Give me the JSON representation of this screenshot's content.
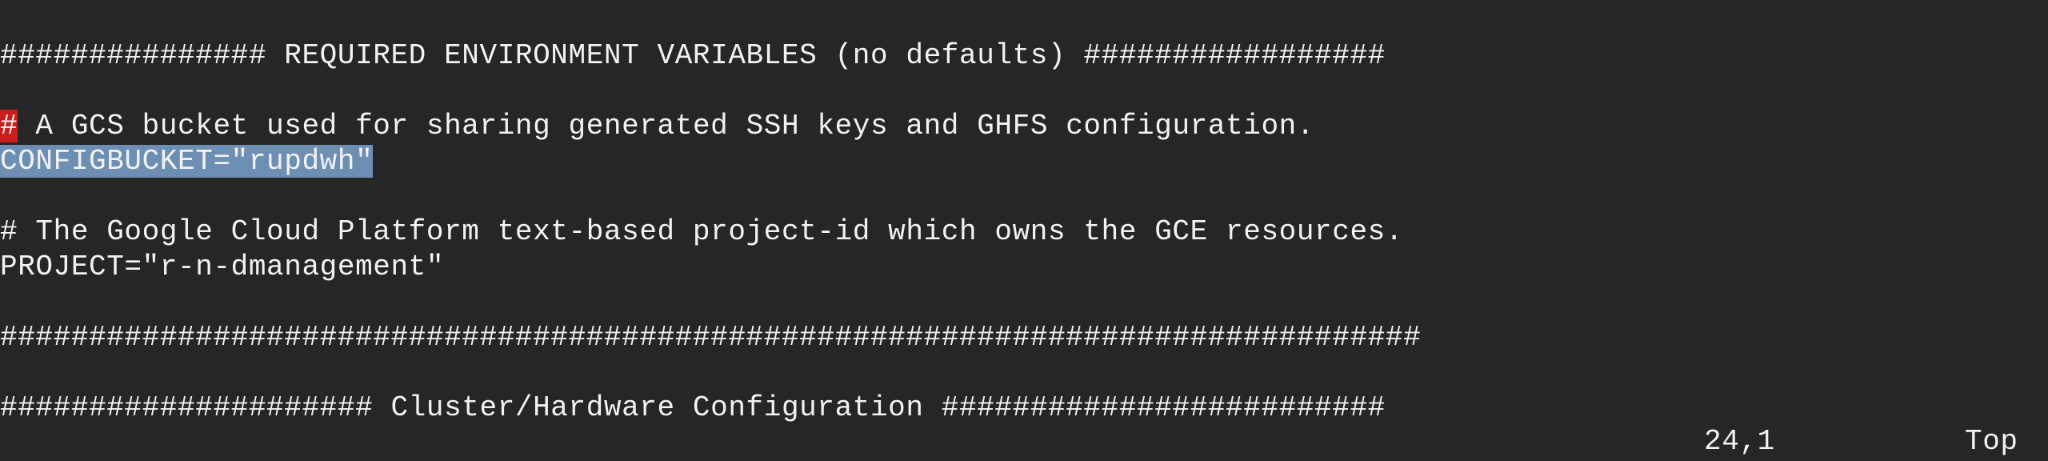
{
  "editor": {
    "lines": {
      "l1": "############### REQUIRED ENVIRONMENT VARIABLES (no defaults) #################",
      "l2": "",
      "l3_cursor": "#",
      "l3_rest": " A GCS bucket used for sharing generated SSH keys and GHFS configuration.",
      "l4_selected": "CONFIGBUCKET=\"rupdwh\"",
      "l5": "",
      "l6": "# The Google Cloud Platform text-based project-id which owns the GCE resources.",
      "l7": "PROJECT=\"r-n-dmanagement\"",
      "l8": "",
      "l9": "################################################################################",
      "l10": "",
      "l11": "##################### Cluster/Hardware Configuration #########################"
    },
    "status": {
      "cursor_position": "24,1",
      "scroll_position": "Top"
    }
  },
  "colors": {
    "background": "#262626",
    "foreground": "#f2f2f2",
    "cursor": "#c71d1d",
    "selection": "#6e8fb4"
  }
}
